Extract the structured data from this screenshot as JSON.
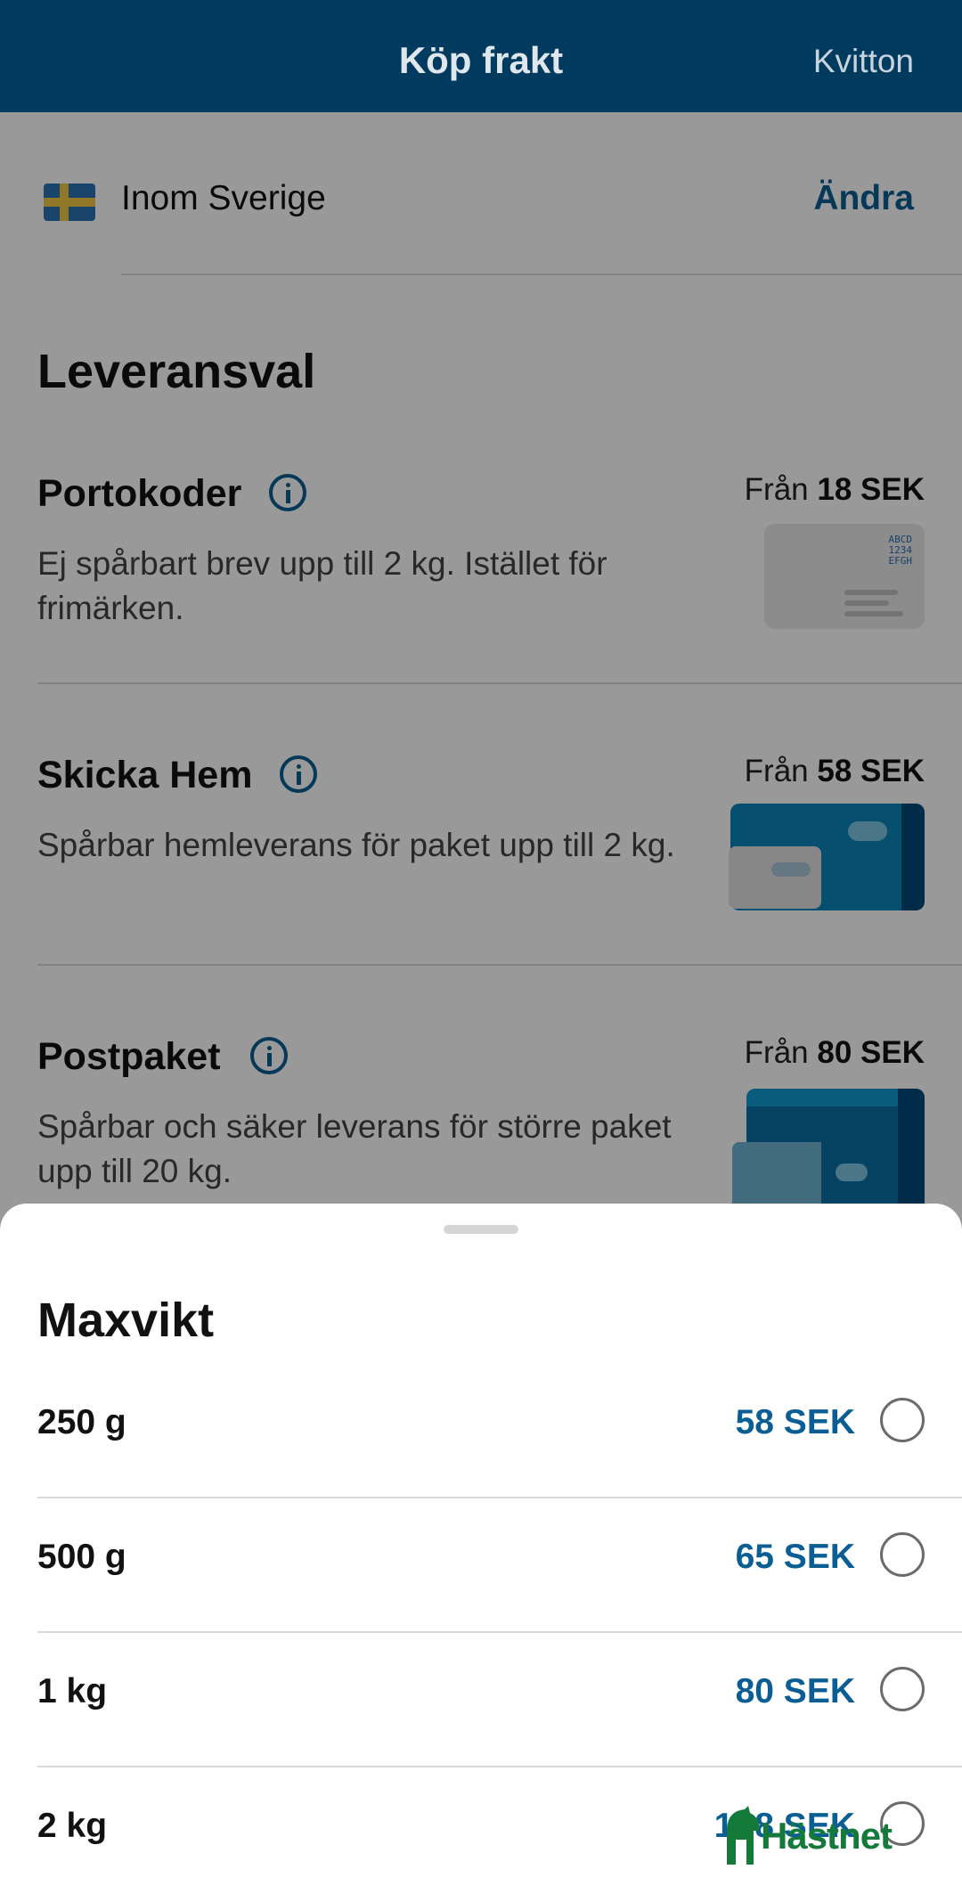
{
  "header": {
    "title": "Köp frakt",
    "receipt_label": "Kvitton"
  },
  "region": {
    "label": "Inom Sverige",
    "change_label": "Ändra"
  },
  "section": {
    "title": "Leveransval"
  },
  "options": [
    {
      "title": "Portokoder",
      "price_prefix": "Från",
      "price": "18 SEK",
      "description": "Ej spårbart brev upp till 2 kg. Istället för frimärken.",
      "code_lines": [
        "ABCD",
        "1234",
        "EFGH"
      ]
    },
    {
      "title": "Skicka Hem",
      "price_prefix": "Från",
      "price": "58 SEK",
      "description": "Spårbar hemleverans för paket upp till 2 kg."
    },
    {
      "title": "Postpaket",
      "price_prefix": "Från",
      "price": "80 SEK",
      "description": "Spårbar och säker leverans för större paket upp till 20 kg."
    }
  ],
  "sheet": {
    "title": "Maxvikt",
    "rows": [
      {
        "weight": "250 g",
        "price": "58 SEK"
      },
      {
        "weight": "500 g",
        "price": "65 SEK"
      },
      {
        "weight": "1 kg",
        "price": "80 SEK"
      },
      {
        "weight": "2 kg",
        "price": "1?8 SEK"
      }
    ]
  },
  "watermark": {
    "text": "Hästnet"
  },
  "colors": {
    "header_bg": "#003a5f",
    "accent": "#0b5e93",
    "watermark": "#137a3a"
  }
}
